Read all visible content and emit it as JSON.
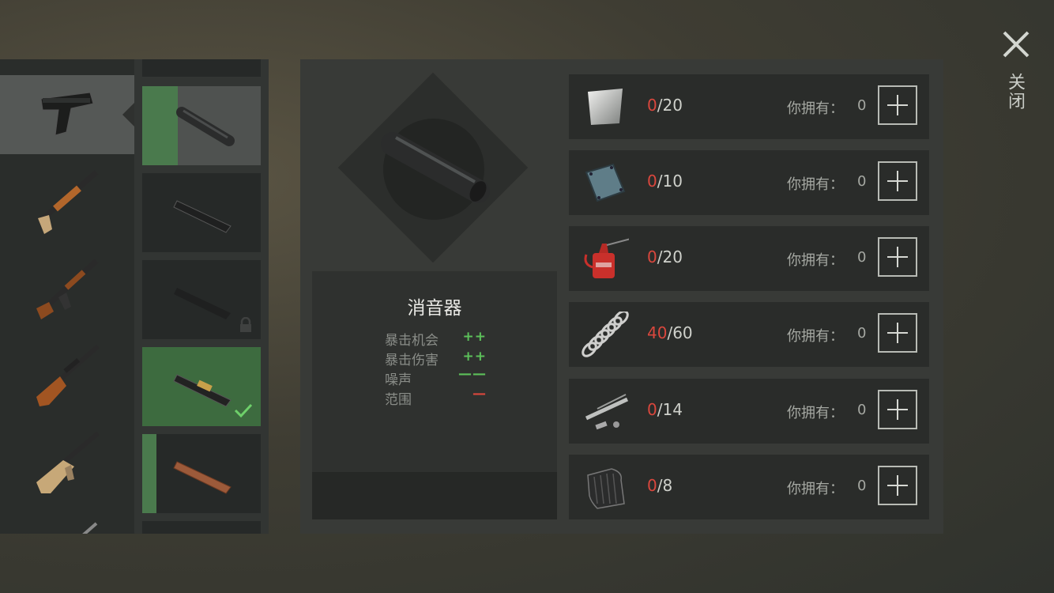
{
  "close": {
    "label": "关闭"
  },
  "weapons": [
    {
      "name": "pistol-icon"
    },
    {
      "name": "shotgun-icon"
    },
    {
      "name": "ak-rifle-icon"
    },
    {
      "name": "sniper-rifle-icon"
    },
    {
      "name": "assault-rifle-icon"
    },
    {
      "name": "rifle-partial-icon"
    }
  ],
  "attachments": [
    {
      "name": "silencer-icon",
      "state": "selected"
    },
    {
      "name": "slide-dark-icon",
      "state": "normal"
    },
    {
      "name": "slide-locked-icon",
      "state": "locked"
    },
    {
      "name": "slide-gold-icon",
      "state": "equipped"
    },
    {
      "name": "slide-copper-icon",
      "state": "progress"
    }
  ],
  "detail": {
    "title": "消音器",
    "stats": [
      {
        "label": "暴击机会",
        "value": "++",
        "color": "#5cc05a"
      },
      {
        "label": "暴击伤害",
        "value": "++",
        "color": "#5cc05a"
      },
      {
        "label": "噪声",
        "value": "——",
        "color": "#5cc05a"
      },
      {
        "label": "范围",
        "value": "—",
        "color": "#d9473d"
      }
    ]
  },
  "materials": [
    {
      "icon": "metal-sheet-icon",
      "current": "0",
      "required": "/20",
      "own_label": "你拥有：",
      "own": "0"
    },
    {
      "icon": "metal-plate-icon",
      "current": "0",
      "required": "/10",
      "own_label": "你拥有：",
      "own": "0"
    },
    {
      "icon": "oil-can-icon",
      "current": "0",
      "required": "/20",
      "own_label": "你拥有：",
      "own": "0"
    },
    {
      "icon": "spring-icon",
      "current": "40",
      "required": "/60",
      "own_label": "你拥有：",
      "own": "0"
    },
    {
      "icon": "gun-parts-icon",
      "current": "0",
      "required": "/14",
      "own_label": "你拥有：",
      "own": "0"
    },
    {
      "icon": "rubber-sheet-icon",
      "current": "0",
      "required": "/8",
      "own_label": "你拥有：",
      "own": "0"
    }
  ]
}
